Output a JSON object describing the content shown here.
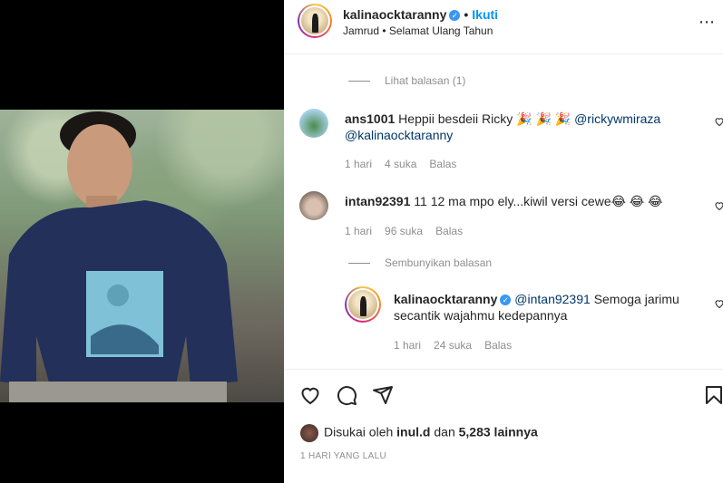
{
  "post": {
    "username": "kalinaocktaranny",
    "follow_label": "Ikuti",
    "subtitle": "Jamrud • Selamat Ulang Tahun"
  },
  "comments": {
    "view_replies_1": "Lihat balasan (1)",
    "c1": {
      "username": "ans1001",
      "text": "Heppii besdeii Ricky 🎉 🎉 🎉",
      "mention1": "@rickywmiraza",
      "mention2": "@kalinaocktaranny",
      "time": "1 hari",
      "likes": "4 suka",
      "reply": "Balas"
    },
    "c2": {
      "username": "intan92391",
      "text": "11 12 ma mpo ely...kiwil versi cewe😂 😂 😂",
      "time": "1 hari",
      "likes": "96 suka",
      "reply": "Balas"
    },
    "hide_replies": "Sembunyikan balasan",
    "r1": {
      "username": "kalinaocktaranny",
      "mention": "@intan92391",
      "text": "Semoga jarimu secantik wajahmu kedepannya",
      "time": "1 hari",
      "likes": "24 suka",
      "reply": "Balas"
    }
  },
  "actions": {
    "liked_prefix": "Disukai oleh",
    "liked_user": "inul.d",
    "liked_mid": "dan",
    "liked_count": "5,283 lainnya",
    "date": "1 HARI YANG LALU"
  },
  "colors": {
    "link_blue": "#0095f6",
    "mention_blue": "#00376b",
    "muted_gray": "#8e8e8e"
  },
  "icons": [
    "heart-icon",
    "comment-icon",
    "share-icon",
    "bookmark-icon",
    "more-options-icon",
    "verified-badge-icon"
  ]
}
